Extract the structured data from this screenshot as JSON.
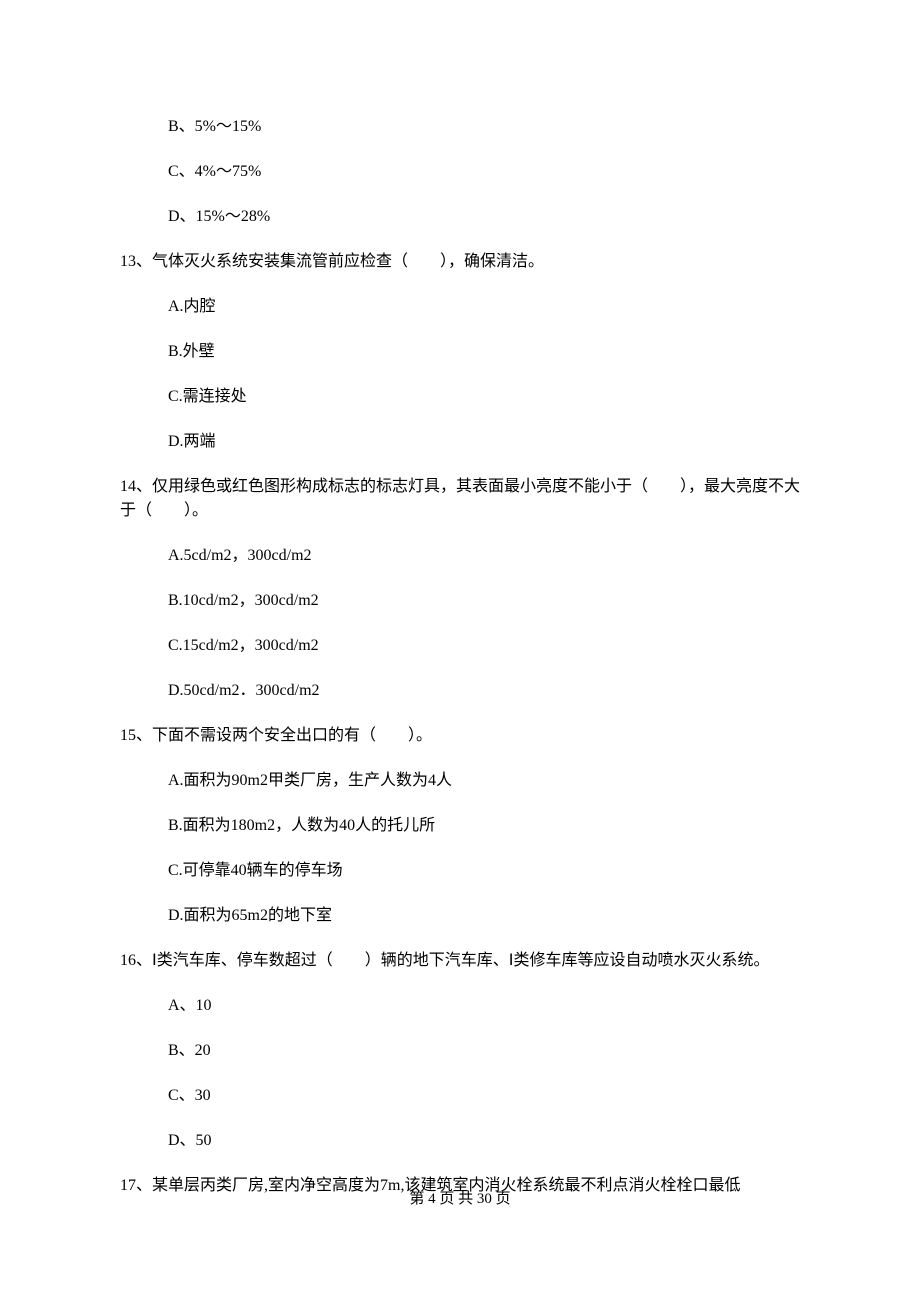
{
  "q12": {
    "options": {
      "b": "B、5%～15%",
      "c": "C、4%～75%",
      "d": "D、15%～28%"
    }
  },
  "q13": {
    "stem": "13、气体灭火系统安装集流管前应检查（　　），确保清洁。",
    "options": {
      "a": "A.内腔",
      "b": "B.外壁",
      "c": "C.需连接处",
      "d": "D.两端"
    }
  },
  "q14": {
    "stem": "14、仅用绿色或红色图形构成标志的标志灯具，其表面最小亮度不能小于（　　），最大亮度不大于（　　）。",
    "options": {
      "a": "A.5cd/m2，300cd/m2",
      "b": "B.10cd/m2，300cd/m2",
      "c": "C.15cd/m2，300cd/m2",
      "d": "D.50cd/m2．300cd/m2"
    }
  },
  "q15": {
    "stem": "15、下面不需设两个安全出口的有（　　）。",
    "options": {
      "a": "A.面积为90m2甲类厂房，生产人数为4人",
      "b": "B.面积为180m2，人数为40人的托儿所",
      "c": "C.可停靠40辆车的停车场",
      "d": "D.面积为65m2的地下室"
    }
  },
  "q16": {
    "stem": "16、Ⅰ类汽车库、停车数超过（　　）辆的地下汽车库、Ⅰ类修车库等应设自动喷水灭火系统。",
    "options": {
      "a": "A、10",
      "b": "B、20",
      "c": "C、30",
      "d": "D、50"
    }
  },
  "q17": {
    "stem": "17、某单层丙类厂房,室内净空高度为7m,该建筑室内消火栓系统最不利点消火栓栓口最低"
  },
  "footer": "第 4 页 共 30 页"
}
